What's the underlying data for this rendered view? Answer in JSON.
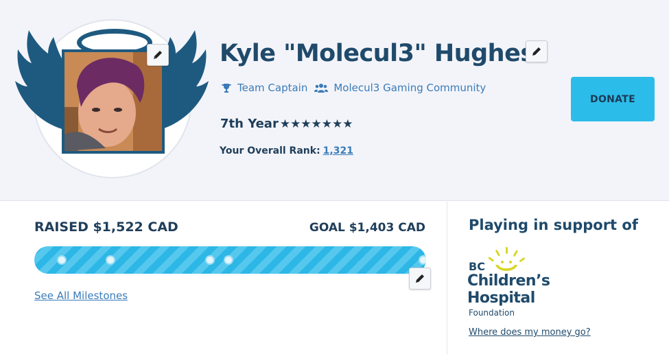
{
  "profile": {
    "name": "Kyle \"Molecul3\" Hughes",
    "role": "Team Captain",
    "team": "Molecul3 Gaming Community",
    "years": "7th Year",
    "stars": "★★★★★★★",
    "rank_label": "Your Overall Rank:",
    "rank_value": "1,321"
  },
  "donate_label": "DONATE",
  "fundraising": {
    "raised": "RAISED $1,522 CAD",
    "goal": "GOAL $1,403 CAD",
    "progress_fraction": 1.0,
    "milestone_fractions": [
      0.07,
      0.195,
      0.448,
      0.495,
      0.993
    ],
    "milestones_link": "See All Milestones"
  },
  "support": {
    "title": "Playing in support of",
    "logo_text": [
      "BC",
      "Children’s",
      "Hospital",
      "Foundation"
    ],
    "money_link": "Where does my money go?"
  },
  "colors": {
    "navy": "#1f4a6b",
    "accent": "#2cbcea",
    "link": "#3a7bb8",
    "logo_yellow": "#d9d62a"
  },
  "icons": [
    "pencil-icon",
    "trophy-icon",
    "users-icon",
    "wings-icon",
    "halo-icon"
  ]
}
